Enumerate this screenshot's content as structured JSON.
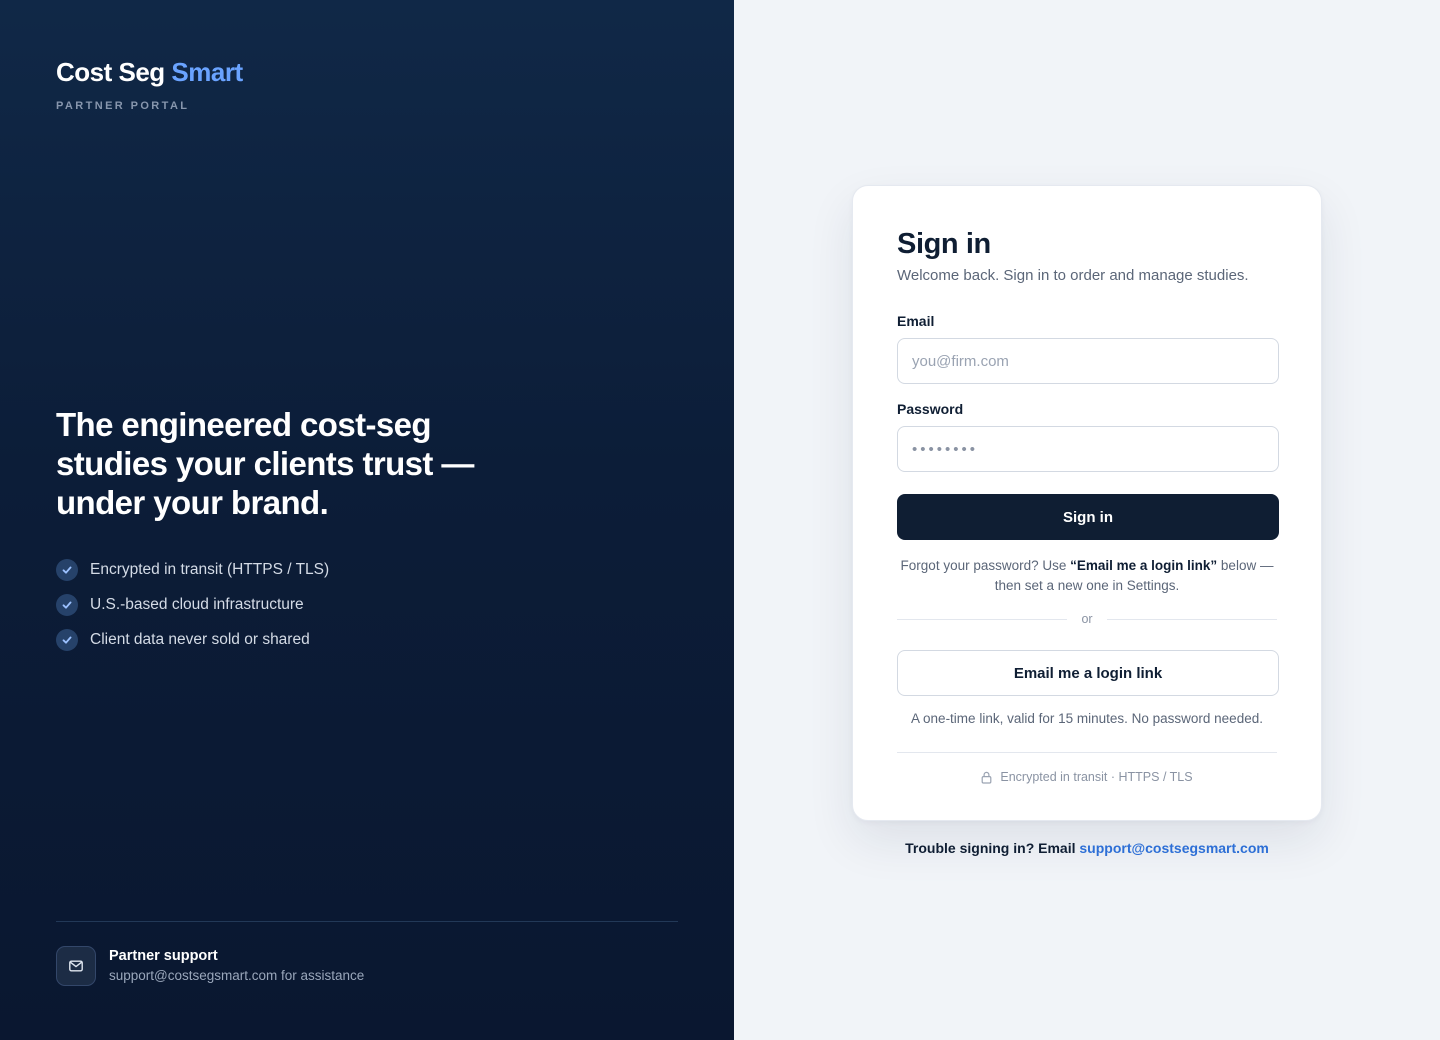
{
  "brand": {
    "name_primary": "Cost Seg",
    "name_accent": "Smart",
    "subtitle": "PARTNER PORTAL",
    "accent_color": "#6aa3ff"
  },
  "hero": {
    "headline": "The engineered cost-seg studies your clients trust — under your brand.",
    "features": [
      {
        "icon": "check-icon",
        "label": "Encrypted in transit (HTTPS / TLS)"
      },
      {
        "icon": "check-icon",
        "label": "U.S.-based cloud infrastructure"
      },
      {
        "icon": "check-icon",
        "label": "Client data never sold or shared"
      }
    ]
  },
  "support": {
    "icon": "mail-icon",
    "title": "Partner support",
    "text": "support@costsegsmart.com for assistance"
  },
  "signin": {
    "title": "Sign in",
    "subtitle": "Welcome back. Sign in to order and manage studies.",
    "email_label": "Email",
    "email_placeholder": "you@firm.com",
    "email_value": "",
    "password_label": "Password",
    "password_placeholder": "••••••••",
    "password_value": "",
    "submit_label": "Sign in",
    "forgot_prefix": "Forgot your password? Use ",
    "forgot_emphasis": "“Email me a login link”",
    "forgot_suffix": " below — then set a new one in Settings.",
    "or_text": "or",
    "magic_link_label": "Email me a login link",
    "magic_link_note": "A one-time link, valid for 15 minutes. No password needed.",
    "security_icon": "lock-icon",
    "security_note": "Encrypted in transit · HTTPS / TLS",
    "primary_color": "#0f1e33"
  },
  "trouble": {
    "prefix": "Trouble signing in? Email ",
    "email": "support@costsegsmart.com",
    "link_color": "#2d6fd6"
  }
}
